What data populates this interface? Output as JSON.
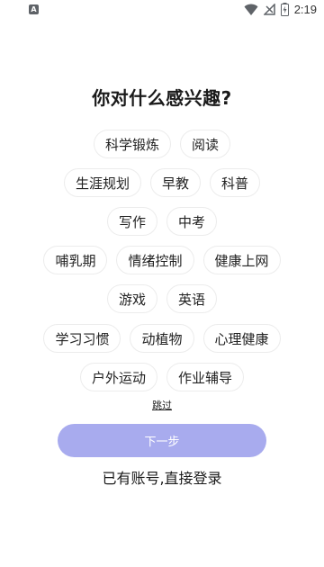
{
  "status_bar": {
    "app_badge": "A",
    "time": "2:19"
  },
  "title": "你对什么感兴趣?",
  "interest_rows": [
    [
      "科学锻炼",
      "阅读"
    ],
    [
      "生涯规划",
      "早教",
      "科普"
    ],
    [
      "写作",
      "中考"
    ],
    [
      "哺乳期",
      "情绪控制",
      "健康上网"
    ],
    [
      "游戏",
      "英语"
    ],
    [
      "学习习惯",
      "动植物",
      "心理健康"
    ],
    [
      "户外运动",
      "作业辅导"
    ]
  ],
  "skip_label": "跳过",
  "next_button_label": "下一步",
  "login_link": "已有账号,直接登录"
}
